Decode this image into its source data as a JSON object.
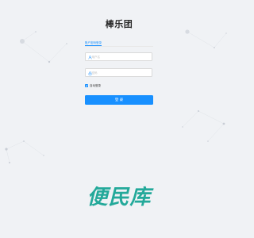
{
  "app": {
    "title": "棒乐团"
  },
  "login": {
    "tab_label": "账户密码登录",
    "username_placeholder": "用户名",
    "password_placeholder": "密码",
    "remember_label": "自动登录",
    "remember_checked": true,
    "submit_label": "登 录"
  },
  "watermark": {
    "text": "便民库"
  },
  "colors": {
    "accent": "#1890ff",
    "watermark": "#23a99a",
    "background": "#f0f2f5"
  },
  "icons": {
    "username": "user-icon",
    "password": "lock-icon",
    "checkbox": "check-icon"
  }
}
